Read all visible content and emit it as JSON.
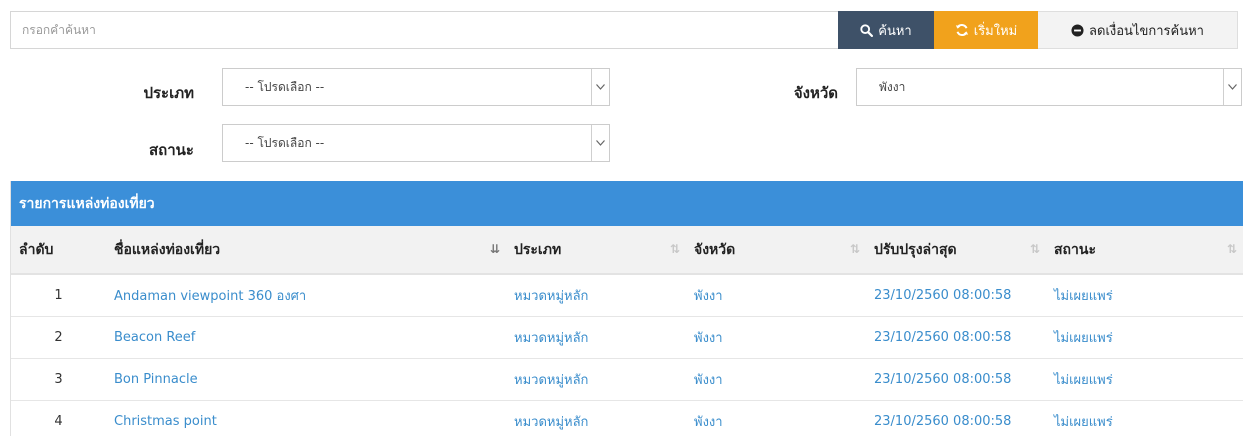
{
  "search": {
    "placeholder": "กรอกคำค้นหา",
    "value": "",
    "search_label": "ค้นหา",
    "reset_label": "เริ่มใหม่",
    "less_label": "ลดเงื่อนไขการค้นหา"
  },
  "filters": {
    "type": {
      "label": "ประเภท",
      "value": "-- โปรดเลือก --"
    },
    "province": {
      "label": "จังหวัด",
      "value": "พังงา"
    },
    "status": {
      "label": "สถานะ",
      "value": "-- โปรดเลือก --"
    }
  },
  "panel": {
    "title": "รายการแหล่งท่องเที่ยว"
  },
  "table": {
    "columns": [
      "ลำดับ",
      "ชื่อแหล่งท่องเที่ยว",
      "ประเภท",
      "จังหวัด",
      "ปรับปรุงล่าสุด",
      "สถานะ"
    ],
    "rows": [
      {
        "no": "1",
        "name": "Andaman viewpoint 360 องศา",
        "type": "หมวดหมู่หลัก",
        "province": "พังงา",
        "updated": "23/10/2560 08:00:58",
        "status": "ไม่เผยแพร่"
      },
      {
        "no": "2",
        "name": "Beacon Reef",
        "type": "หมวดหมู่หลัก",
        "province": "พังงา",
        "updated": "23/10/2560 08:00:58",
        "status": "ไม่เผยแพร่"
      },
      {
        "no": "3",
        "name": "Bon Pinnacle",
        "type": "หมวดหมู่หลัก",
        "province": "พังงา",
        "updated": "23/10/2560 08:00:58",
        "status": "ไม่เผยแพร่"
      },
      {
        "no": "4",
        "name": "Christmas point",
        "type": "หมวดหมู่หลัก",
        "province": "พังงา",
        "updated": "23/10/2560 08:00:58",
        "status": "ไม่เผยแพร่"
      }
    ]
  },
  "icons": {
    "search": "search-icon",
    "reset": "refresh-icon",
    "less": "minus-circle-icon",
    "sort": "sort-icon",
    "sort_active": "sort-amount-desc-icon",
    "caret": "chevron-down-icon"
  },
  "colors": {
    "search_button": "#3e5168",
    "reset_button": "#f1a21c",
    "panel_header": "#3b8fd9",
    "link": "#3a8dcc"
  }
}
